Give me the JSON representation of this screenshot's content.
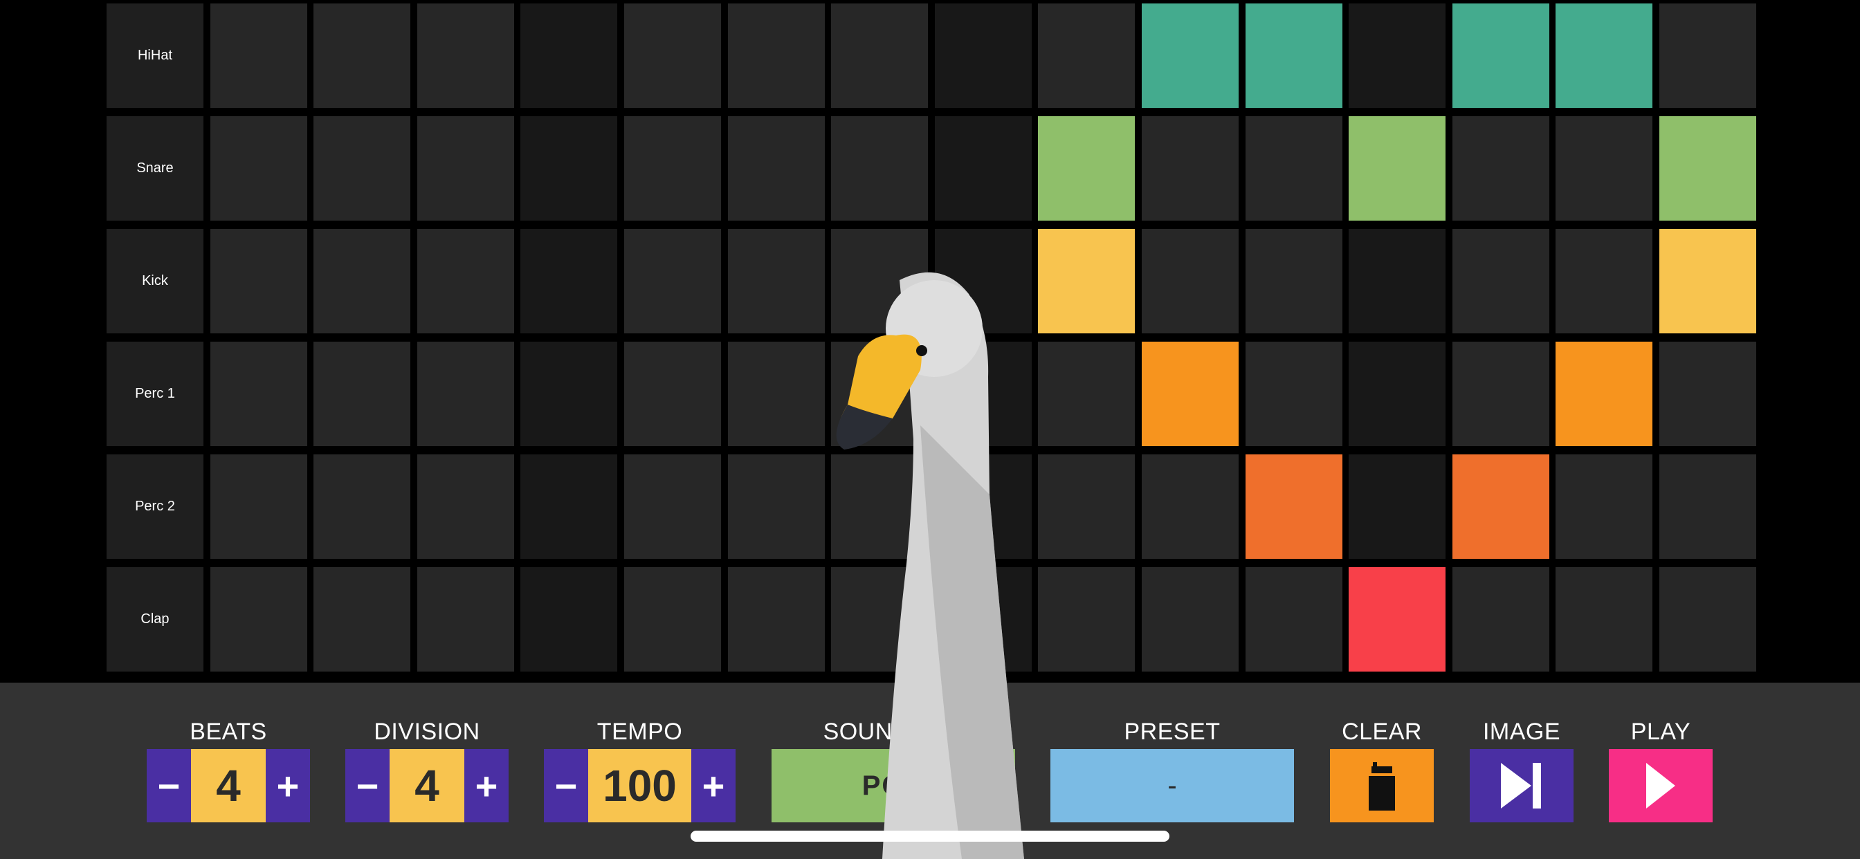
{
  "rows": [
    {
      "label": "HiHat",
      "color": "#44ab8e",
      "active": [
        10,
        11,
        13,
        14
      ]
    },
    {
      "label": "Snare",
      "color": "#8fbf6a",
      "active": [
        9,
        12,
        15
      ]
    },
    {
      "label": "Kick",
      "color": "#f8c44f",
      "active": [
        9,
        15
      ]
    },
    {
      "label": "Perc 1",
      "color": "#f7941e",
      "active": [
        10,
        14
      ]
    },
    {
      "label": "Perc 2",
      "color": "#ef6f2c",
      "active": [
        11,
        13
      ]
    },
    {
      "label": "Clap",
      "color": "#f84049",
      "active": [
        12
      ]
    }
  ],
  "dim_columns": [
    4,
    8,
    12
  ],
  "controls": {
    "beats": {
      "title": "BEATS",
      "value": "4",
      "minus": "−",
      "plus": "+"
    },
    "division": {
      "title": "DIVISION",
      "value": "4",
      "minus": "−",
      "plus": "+"
    },
    "tempo": {
      "title": "TEMPO",
      "value": "100",
      "minus": "−",
      "plus": "+"
    },
    "sound_set": {
      "title": "SOUND SET",
      "value": "POP",
      "color": "#8fbf6a"
    },
    "preset": {
      "title": "PRESET",
      "value": "-",
      "color": "#7bbbe4"
    },
    "clear": {
      "title": "CLEAR",
      "icon": "trash-icon",
      "color": "#f7941e"
    },
    "image": {
      "title": "IMAGE",
      "icon": "skip-next-icon",
      "color": "#4a2fa3"
    },
    "play": {
      "title": "PLAY",
      "icon": "play-icon",
      "color": "#f72e86"
    }
  },
  "overlay": {
    "icon": "swan-image"
  }
}
